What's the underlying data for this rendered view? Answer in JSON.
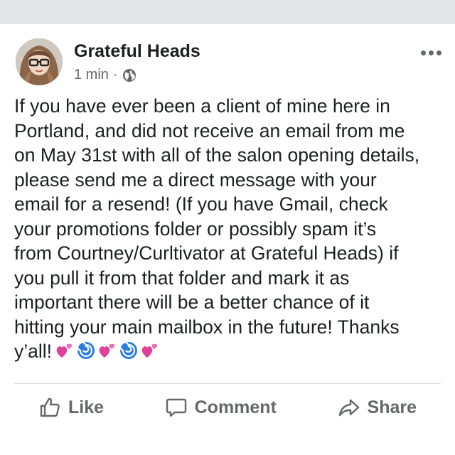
{
  "post": {
    "author": "Grateful Heads",
    "time": "1 min",
    "separator": "·",
    "privacy_icon": "globe-icon",
    "more_icon": "more-options-icon",
    "text": "If you have ever been a client of mine here in\nPortland, and did not receive an email from me\non May 31st with all of the salon opening details,\nplease send me a direct message with your\nemail for a resend! (If you have Gmail, check\nyour promotions folder or possibly spam it’s\nfrom Courtney/Curltivator at Grateful Heads) if\nyou pull it from that folder and mark it as\nimportant there will be a better chance of it\nhitting your main mailbox in the future! Thanks\ny’all!",
    "emojis": [
      "two-hearts-emoji",
      "cyclone-emoji",
      "two-hearts-emoji",
      "cyclone-emoji",
      "two-hearts-emoji"
    ]
  },
  "actions": {
    "like": "Like",
    "comment": "Comment",
    "share": "Share"
  },
  "colors": {
    "text": "#1c1e21",
    "secondary": "#65676b",
    "heart": "#e0409a",
    "cyclone": "#2a7de1",
    "divider": "#dadde1",
    "strip": "#e4e6ea"
  }
}
